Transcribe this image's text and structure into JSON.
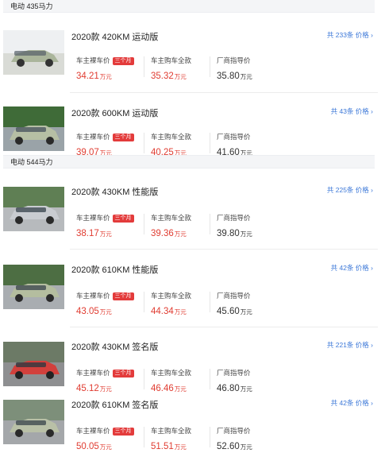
{
  "groups": [
    {
      "header": "电动 435马力"
    },
    {
      "header": "电动 544马力"
    }
  ],
  "cards": [
    {
      "title": "2020款 420KM 运动版",
      "more": "共 233条 价格 ›",
      "owner_label": "车主裸车价",
      "badge": "三个月",
      "owner_price": "34.21",
      "full_label": "车主购车全款",
      "full_price": "35.32",
      "msrp_label": "厂商指导价",
      "msrp_price": "35.80",
      "unit": "万元",
      "car_color": "#aab59b"
    },
    {
      "title": "2020款 600KM 运动版",
      "more": "共 43条 价格 ›",
      "owner_label": "车主裸车价",
      "badge": "三个月",
      "owner_price": "39.07",
      "full_label": "车主购车全款",
      "full_price": "40.25",
      "msrp_label": "厂商指导价",
      "msrp_price": "41.60",
      "unit": "万元",
      "car_color": "#b6bfa4"
    },
    {
      "title": "2020款 430KM 性能版",
      "more": "共 225条 价格 ›",
      "owner_label": "车主裸车价",
      "badge": "三个月",
      "owner_price": "38.17",
      "full_label": "车主购车全款",
      "full_price": "39.36",
      "msrp_label": "厂商指导价",
      "msrp_price": "39.80",
      "unit": "万元",
      "car_color": "#c9ccd1"
    },
    {
      "title": "2020款 610KM 性能版",
      "more": "共 42条 价格 ›",
      "owner_label": "车主裸车价",
      "badge": "三个月",
      "owner_price": "43.05",
      "full_label": "车主购车全款",
      "full_price": "44.34",
      "msrp_label": "厂商指导价",
      "msrp_price": "45.60",
      "unit": "万元",
      "car_color": "#b4bd9f"
    },
    {
      "title": "2020款 430KM 签名版",
      "more": "共 221条 价格 ›",
      "owner_label": "车主裸车价",
      "badge": "三个月",
      "owner_price": "45.12",
      "full_label": "车主购车全款",
      "full_price": "46.46",
      "msrp_label": "厂商指导价",
      "msrp_price": "46.80",
      "unit": "万元",
      "car_color": "#d2403c"
    },
    {
      "title": "2020款 610KM 签名版",
      "more": "共 42条 价格 ›",
      "owner_label": "车主裸车价",
      "badge": "三个月",
      "owner_price": "50.05",
      "full_label": "车主购车全款",
      "full_price": "51.51",
      "msrp_label": "厂商指导价",
      "msrp_price": "52.60",
      "unit": "万元",
      "car_color": "#b9c0a7"
    }
  ]
}
